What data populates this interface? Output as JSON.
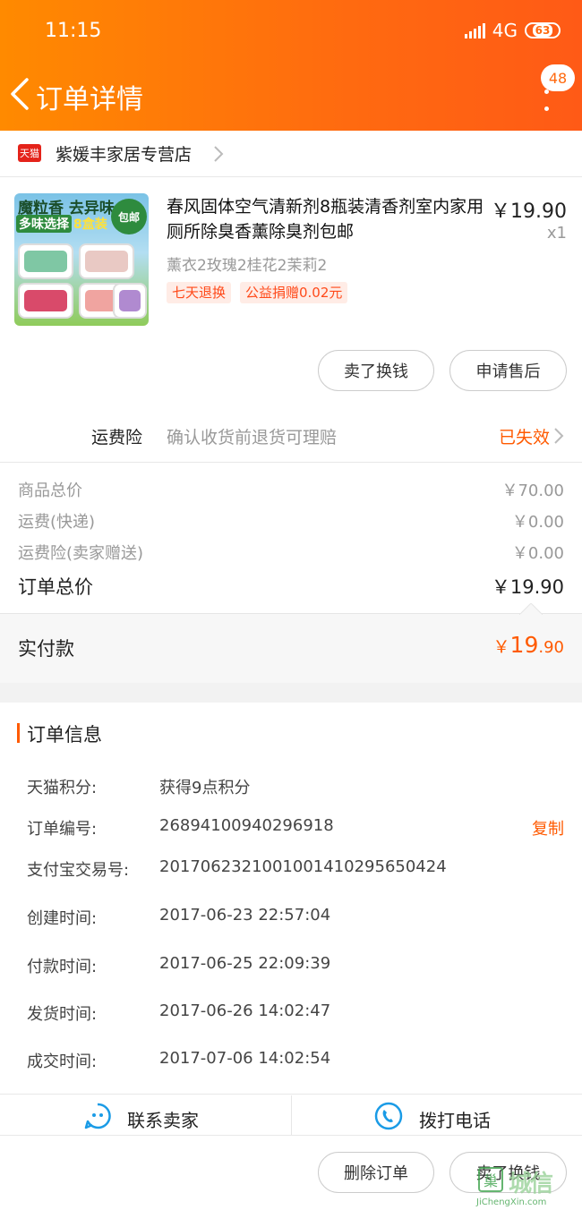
{
  "status_bar": {
    "time": "11:15",
    "network": "4G",
    "battery": "63"
  },
  "nav": {
    "title": "订单详情",
    "badge": "48"
  },
  "store": {
    "logo": "天猫",
    "name": "紫媛丰家居专营店"
  },
  "product": {
    "image_text_1": "魔粒香 去异味",
    "image_text_2": "多味选择",
    "image_text_3": "8盒装",
    "image_badge": "包邮",
    "title": "春风固体空气清新剂8瓶装清香剂室内家用厕所除臭香薰除臭剂包邮",
    "price": "￥19.90",
    "qty": "x1",
    "sku": "薰衣2玫瑰2桂花2茉莉2",
    "tags": [
      "七天退换",
      "公益捐赠0.02元"
    ]
  },
  "item_actions": {
    "sell_label": "卖了换钱",
    "aftersale_label": "申请售后"
  },
  "insurance": {
    "label": "运费险",
    "desc": "确认收货前退货可理赔",
    "status": "已失效"
  },
  "summary": {
    "goods_label": "商品总价",
    "goods_value": "￥70.00",
    "shipping_label": "运费(快递)",
    "shipping_value": "￥0.00",
    "insurance_label": "运费险(卖家赠送)",
    "insurance_value": "￥0.00",
    "total_label": "订单总价",
    "total_value": "￥19.90",
    "paid_label": "实付款",
    "paid_currency": "￥",
    "paid_int": "19",
    "paid_dec": ".90"
  },
  "order_info": {
    "title": "订单信息",
    "points_label": "天猫积分:",
    "points_value": "获得9点积分",
    "no_label": "订单编号:",
    "no_value": "2689410094029691​8",
    "copy_label": "复制",
    "alipay_label": "支付宝交易号:",
    "alipay_value": "2017062321001001410295650424",
    "created_label": "创建时间:",
    "created_value": "2017-06-23 22:57:04",
    "paid_label": "付款时间:",
    "paid_value": "2017-06-25 22:09:39",
    "shipped_label": "发货时间:",
    "shipped_value": "2017-06-26 14:02:47",
    "done_label": "成交时间:",
    "done_value": "2017-07-06 14:02:54"
  },
  "contact": {
    "seller_label": "联系卖家",
    "phone_label": "拨打电话"
  },
  "footer": {
    "delete_label": "删除订单",
    "sell_label": "卖了换钱"
  },
  "watermark": "JiChengXin.com",
  "colors": {
    "accent": "#ff5a00",
    "header_start": "#ff8a00",
    "header_end": "#ff5a16"
  }
}
